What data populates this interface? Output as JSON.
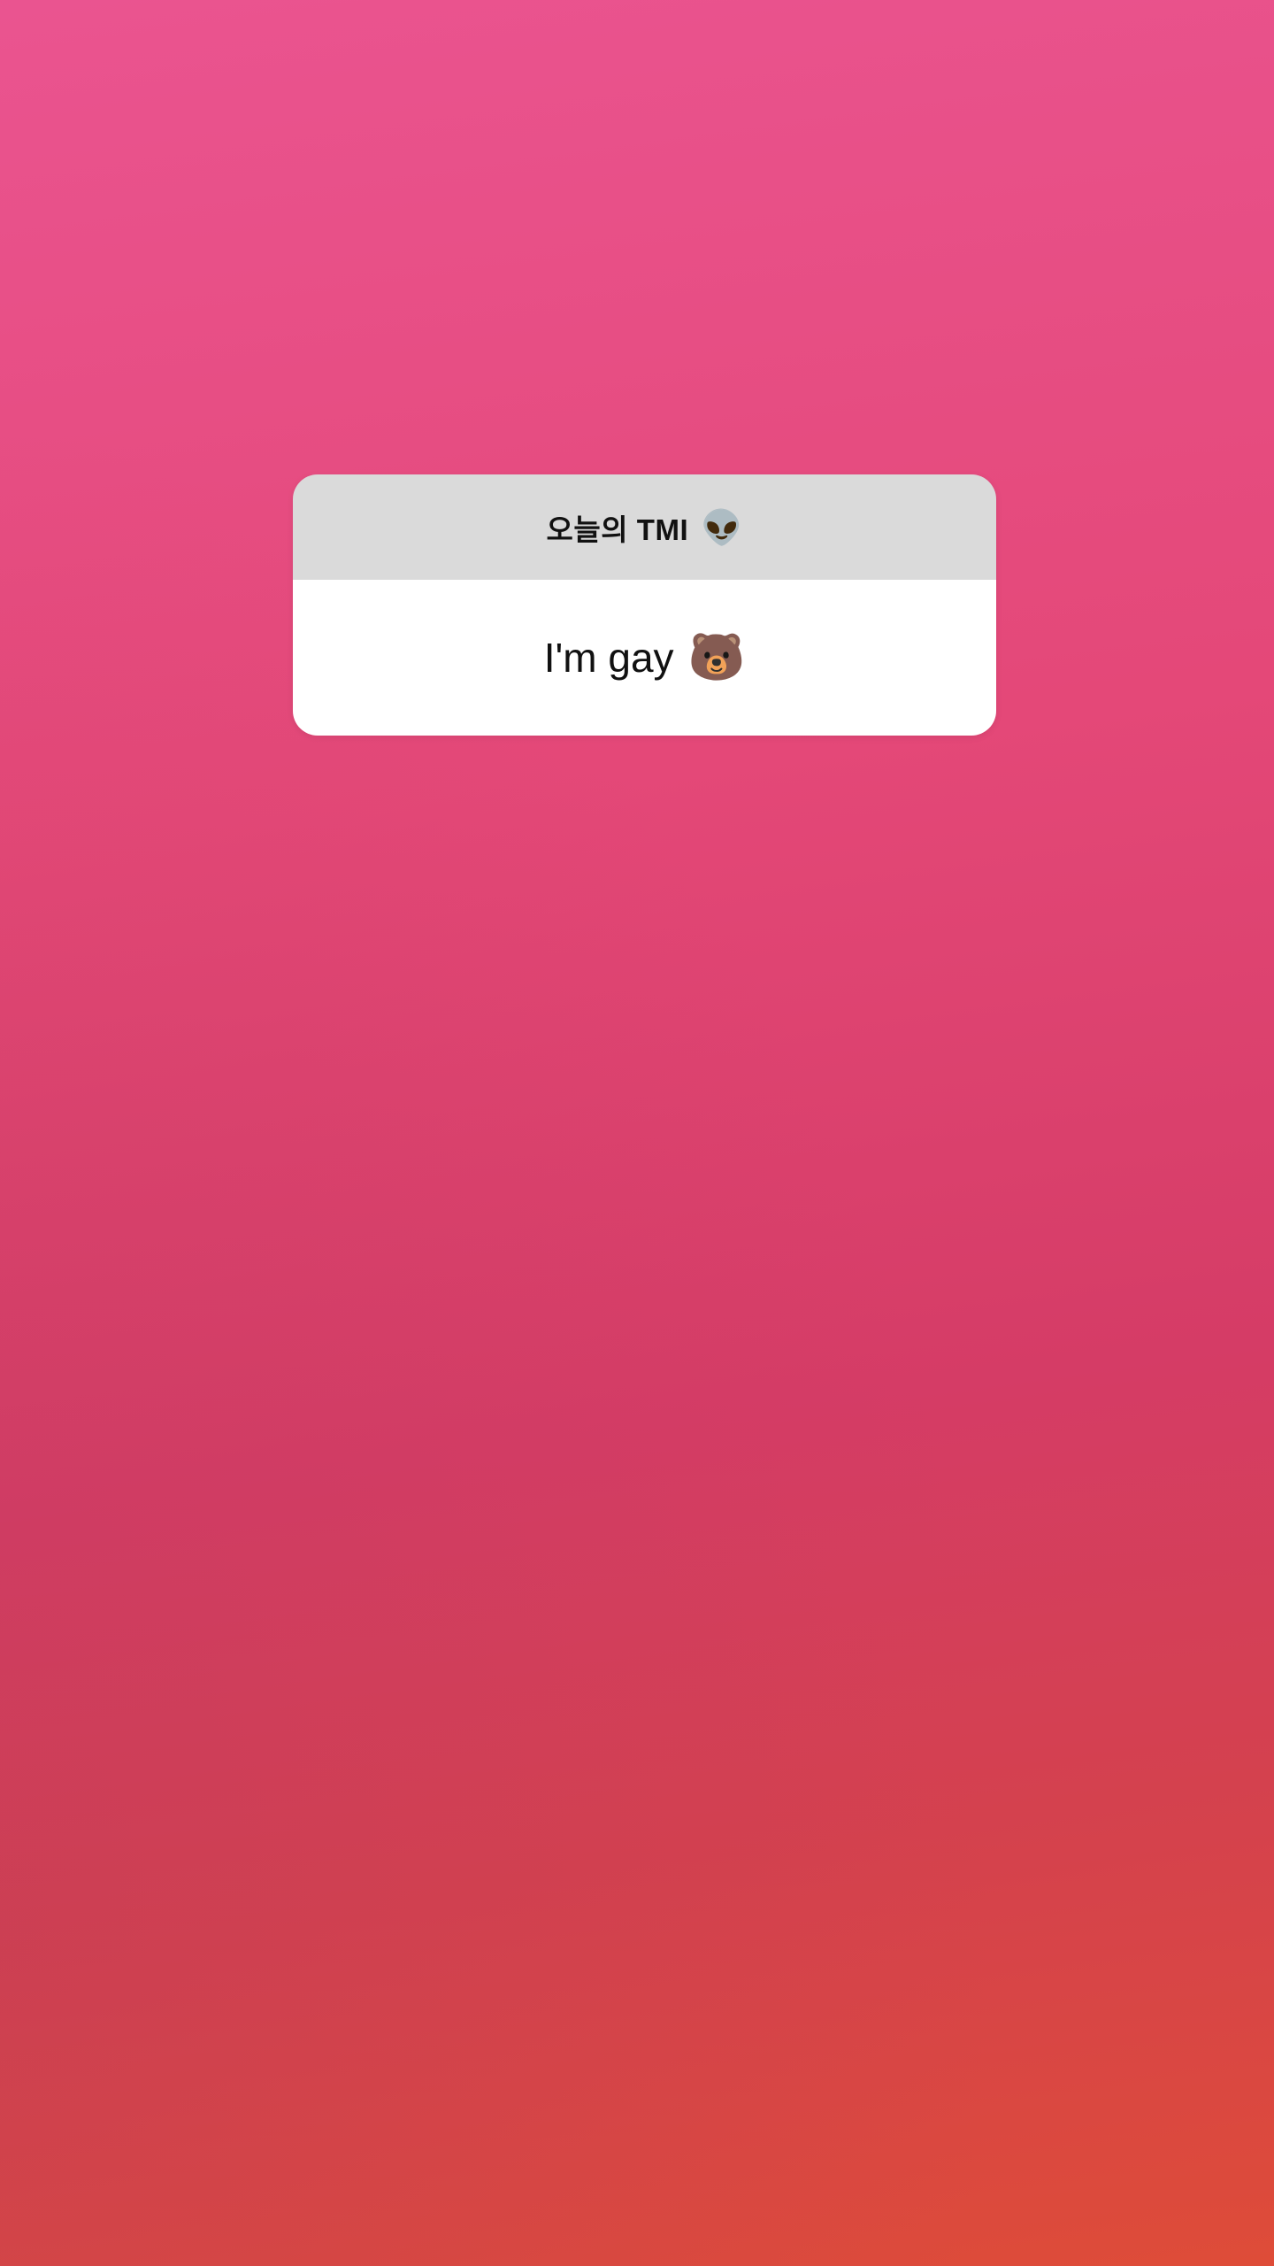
{
  "story": {
    "background_colors": {
      "top": "#ea5490",
      "middle": "#d53c66",
      "bottom": "#de4c38"
    }
  },
  "question_sticker": {
    "prompt": "오늘의 TMI",
    "prompt_emoji": "👽",
    "prompt_emoji_icon": "alien-icon",
    "answer": "I'm gay",
    "answer_emoji": "🐻",
    "answer_emoji_icon": "bear-face-icon",
    "header_color": "#dadada",
    "body_color": "#ffffff"
  }
}
